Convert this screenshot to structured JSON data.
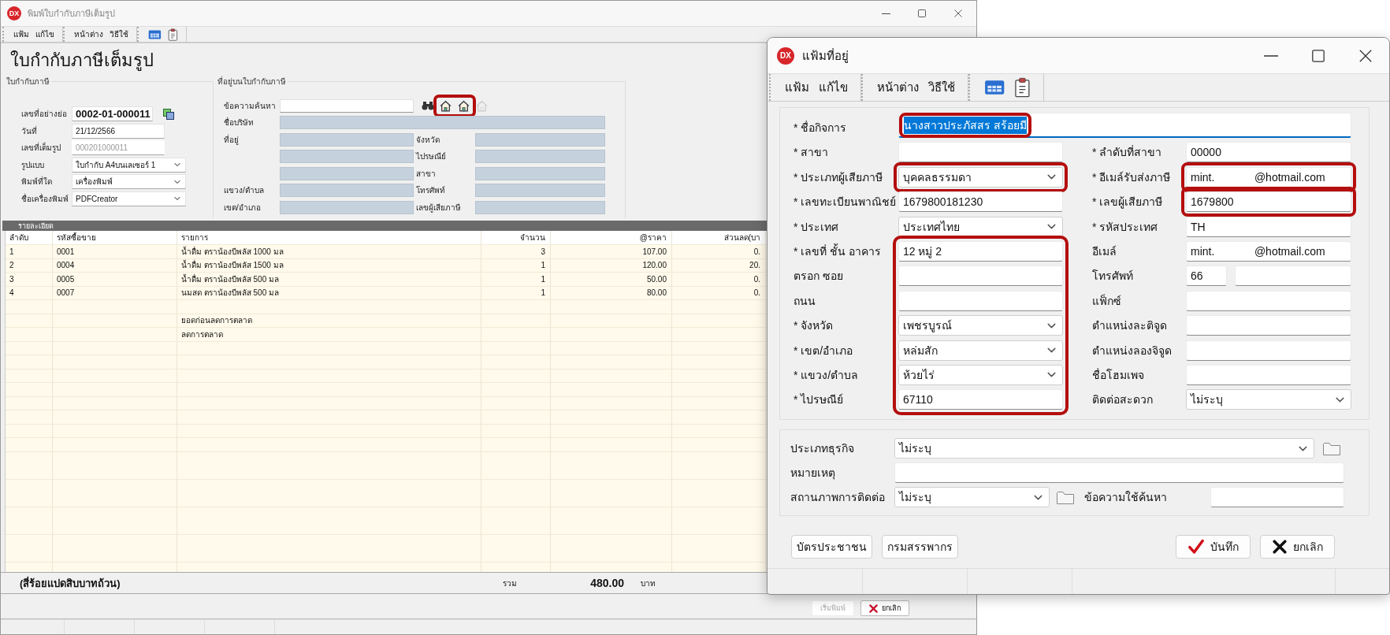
{
  "main_window": {
    "logo": "DX",
    "title": "พิมพ์ใบกำกับภาษีเต็มรูป",
    "menu_groups": [
      [
        "แฟ้ม",
        "แก้ไข"
      ],
      [
        "หน้าต่าง",
        "วิธีใช้"
      ]
    ],
    "heading": "ใบกำกับภาษีเต็มรูป",
    "invoice_group": {
      "title": "ใบกำกับภาษี",
      "fields": [
        {
          "label": "เลขที่อย่างย่อ",
          "value": "0002-01-000011",
          "kind": "bold"
        },
        {
          "label": "วันที่",
          "value": "21/12/2566",
          "kind": "text"
        },
        {
          "label": "เลขที่เต็มรูป",
          "value": "000201000011",
          "kind": "readonly"
        },
        {
          "label": "รูปแบบ",
          "value": "ใบกำกับ A4บนเลเซอร์ 1",
          "kind": "select"
        },
        {
          "label": "พิมพ์ที่ใด",
          "value": "เครื่องพิมพ์",
          "kind": "select"
        },
        {
          "label": "ชื่อเครื่องพิมพ์",
          "value": "PDFCreator",
          "kind": "select"
        }
      ]
    },
    "address_group": {
      "title": "ที่อยู่บนใบกำกับภาษี",
      "search_label": "ข้อความค้นหา",
      "tools_highlighted": true,
      "rows": [
        {
          "kind": "wide",
          "label": "ชื่อบริษัท"
        },
        {
          "kind": "pair",
          "label": "ที่อยู่",
          "right_label": "จังหวัด"
        },
        {
          "kind": "pair",
          "right_label": "ไปรษณีย์"
        },
        {
          "kind": "pair",
          "right_label": "สาขา"
        },
        {
          "kind": "pair",
          "label": "แขวง/ตำบล",
          "right_label": "โทรศัพท์"
        },
        {
          "kind": "pair",
          "label": "เขต/อำเภอ",
          "right_label": "เลขผู้เสียภาษี"
        }
      ]
    },
    "details_title": "รายละเอียด",
    "table": {
      "columns": [
        "ลำดับ",
        "รหัสซื้อขาย",
        "รายการ",
        "จำนวน",
        "@ราคา",
        "ส่วนลด(บา"
      ],
      "rows": [
        {
          "cells": [
            "1",
            "0001",
            "น้ำดื่ม ตราน้องบีพลัส 1000 มล",
            "3",
            "107.00",
            "0."
          ]
        },
        {
          "cells": [
            "2",
            "0004",
            "น้ำดื่ม ตราน้องบีพลัส 1500 มล",
            "1",
            "120.00",
            "20."
          ]
        },
        {
          "cells": [
            "3",
            "0005",
            "น้ำดื่ม ตราน้องบีพลัส 500 มล",
            "1",
            "50.00",
            "0."
          ]
        },
        {
          "cells": [
            "4",
            "0007",
            "นมสด ตราน้องบีพลัส 500 มล",
            "1",
            "80.00",
            "0."
          ]
        }
      ],
      "summary_rows": [
        "ยอดก่อนลดการตลาด",
        "ลดการตลาด"
      ]
    },
    "amount_in_words": "(สี่ร้อยแปดสิบบาทถ้วน)",
    "total_label": "รวม",
    "total": "480.00",
    "currency": "บาท",
    "buttons": [
      {
        "label": "เริ่มพิมพ์",
        "disabled": true
      },
      {
        "label": "ยกเลิก",
        "disabled": false
      }
    ]
  },
  "dialog": {
    "logo": "DX",
    "title": "แฟ้มที่อยู่",
    "menu_groups": [
      [
        "แฟ้ม",
        "แก้ไข"
      ],
      [
        "หน้าต่าง",
        "วิธีใช้"
      ]
    ],
    "name_field": {
      "label": "* ชื่อกิจการ",
      "value": "นางสาวประภัสสร สร้อยมี",
      "highlighted": true,
      "text_selected": true
    },
    "rows": [
      {
        "left": {
          "label": "* สาขา",
          "kind": "text",
          "highlighted": false
        },
        "right": {
          "label": "* ลำดับที่สาขา",
          "value": "00000",
          "kind": "text",
          "highlighted": false
        }
      },
      {
        "left": {
          "label": "* ประเภทผู้เสียภาษี",
          "value": "บุคคลธรรมดา",
          "kind": "select",
          "highlighted": true
        },
        "right": {
          "label": "* อีเมล์รับส่งภาษี",
          "value": "mint.             @hotmail.com",
          "kind": "text",
          "highlighted": true
        }
      },
      {
        "left": {
          "label": "* เลขทะเบียนพาณิชย์",
          "value": "1679800181230",
          "kind": "text",
          "highlighted": false
        },
        "right": {
          "label": "* เลขผู้เสียภาษี",
          "value": "1679800",
          "kind": "text",
          "highlighted": true
        }
      },
      {
        "left": {
          "label": "* ประเทศ",
          "value": "ประเทศไทย",
          "kind": "select",
          "highlighted": false
        },
        "right": {
          "label": "* รหัสประเทศ",
          "value": "TH",
          "kind": "text",
          "highlighted": false
        }
      }
    ],
    "address_highlighted": true,
    "address_rows": [
      {
        "left": {
          "label": "* เลขที่ ชั้น อาคาร",
          "value": "12 หมู่ 2",
          "kind": "text"
        },
        "right": {
          "label": "อีเมล์",
          "value": "mint.             @hotmail.com",
          "kind": "text"
        }
      },
      {
        "left": {
          "label": "ตรอก ซอย",
          "kind": "text"
        },
        "right": {
          "label": "โทรศัพท์",
          "value": "66",
          "kind": "phone"
        }
      },
      {
        "left": {
          "label": "ถนน",
          "kind": "text"
        },
        "right": {
          "label": "แฟ็กซ์",
          "kind": "text"
        }
      },
      {
        "left": {
          "label": "* จังหวัด",
          "value": "เพชรบูรณ์",
          "kind": "select"
        },
        "right": {
          "label": "ตำแหน่งละติจูด",
          "kind": "text"
        }
      },
      {
        "left": {
          "label": "* เขต/อำเภอ",
          "value": "หล่มสัก",
          "kind": "select"
        },
        "right": {
          "label": "ตำแหน่งลองจิจูด",
          "kind": "text"
        }
      },
      {
        "left": {
          "label": "* แขวง/ตำบล",
          "value": "ห้วยไร่",
          "kind": "select"
        },
        "right": {
          "label": "ชื่อโฮมเพจ",
          "kind": "text"
        }
      },
      {
        "left": {
          "label": "* ไปรษณีย์",
          "value": "67110",
          "kind": "text"
        },
        "right": {
          "label": "ติดต่อสะดวก",
          "value": "ไม่ระบุ",
          "kind": "select"
        }
      }
    ],
    "extra": {
      "business_type": {
        "label": "ประเภทธุรกิจ",
        "value": "ไม่ระบุ"
      },
      "note": {
        "label": "หมายเหตุ"
      },
      "contact_status": {
        "label": "สถานภาพการติดต่อ",
        "value": "ไม่ระบุ"
      },
      "search_text": {
        "label": "ข้อความใช้ค้นหา"
      }
    },
    "side_buttons": [
      "บัตรประชาชน",
      "กรมสรรพากร"
    ],
    "buttons": [
      {
        "label": "บันทึก"
      },
      {
        "label": "ยกเลิก"
      }
    ]
  }
}
